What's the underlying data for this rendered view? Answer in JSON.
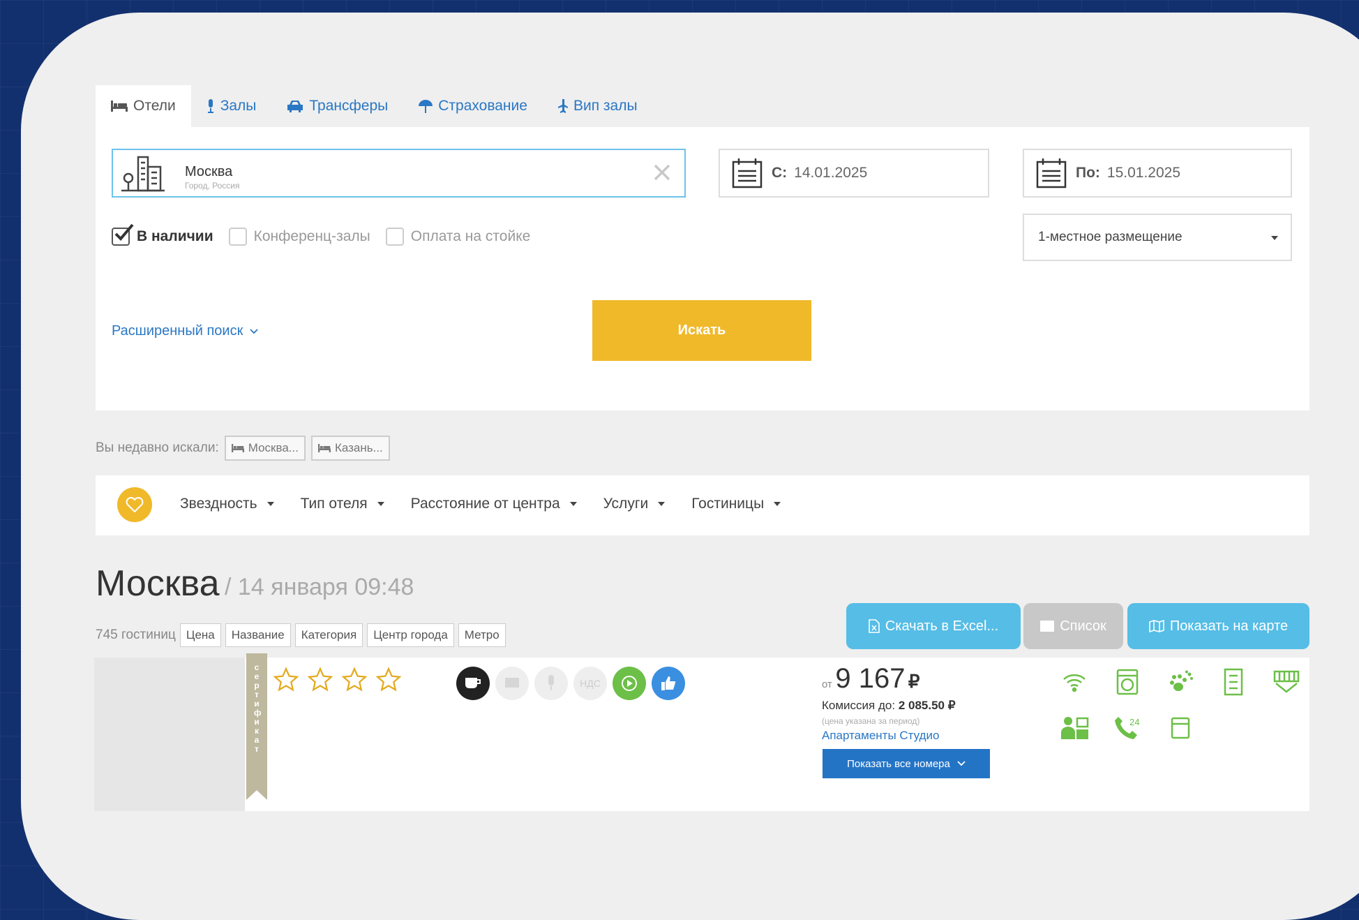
{
  "tabs": [
    {
      "label": "Отели",
      "icon": "bed-icon",
      "active": true
    },
    {
      "label": "Залы",
      "icon": "microphone-icon"
    },
    {
      "label": "Трансферы",
      "icon": "car-icon"
    },
    {
      "label": "Страхование",
      "icon": "umbrella-icon"
    },
    {
      "label": "Вип залы",
      "icon": "plane-icon"
    }
  ],
  "search": {
    "city": "Москва",
    "city_sub": "Город, Россия",
    "date_from_label": "С:",
    "date_from": "14.01.2025",
    "date_to_label": "По:",
    "date_to": "15.01.2025",
    "accommodation": "1-местное размещение",
    "checkboxes": [
      {
        "label": "В наличии",
        "checked": true
      },
      {
        "label": "Конференц-залы",
        "checked": false
      },
      {
        "label": "Оплата на стойке",
        "checked": false
      }
    ],
    "advanced_link": "Расширенный поиск",
    "search_button": "Искать"
  },
  "recent": {
    "label": "Вы недавно искали:",
    "items": [
      "Москва...",
      "Казань..."
    ]
  },
  "filters": [
    "Звездность",
    "Тип отеля",
    "Расстояние от центра",
    "Услуги",
    "Гостиницы"
  ],
  "results": {
    "title": "Москва",
    "subtitle": "/ 14 января 09:48",
    "count": "745 гостиниц",
    "sort_buttons": [
      "Цена",
      "Название",
      "Категория",
      "Центр города",
      "Метро"
    ],
    "excel_button": "Скачать в Excel...",
    "list_button": "Список",
    "map_button": "Показать на карте"
  },
  "hotel": {
    "ribbon_text": "сертификат",
    "stars": 4,
    "amenity_nds": "НДС",
    "price_from": "от",
    "price": "9 167",
    "currency": "₽",
    "commission_label": "Комиссия до:",
    "commission_value": "2 085.50 ₽",
    "price_note": "(цена указана за период)",
    "room_type": "Апартаменты Студио",
    "show_rooms_button": "Показать все номера"
  },
  "colors": {
    "accent_yellow": "#f0b92a",
    "link_blue": "#2a77c4",
    "button_light_blue": "#55bde6",
    "button_blue": "#2474c6",
    "amenity_green": "#6cbf47",
    "background_navy": "#13306e"
  }
}
